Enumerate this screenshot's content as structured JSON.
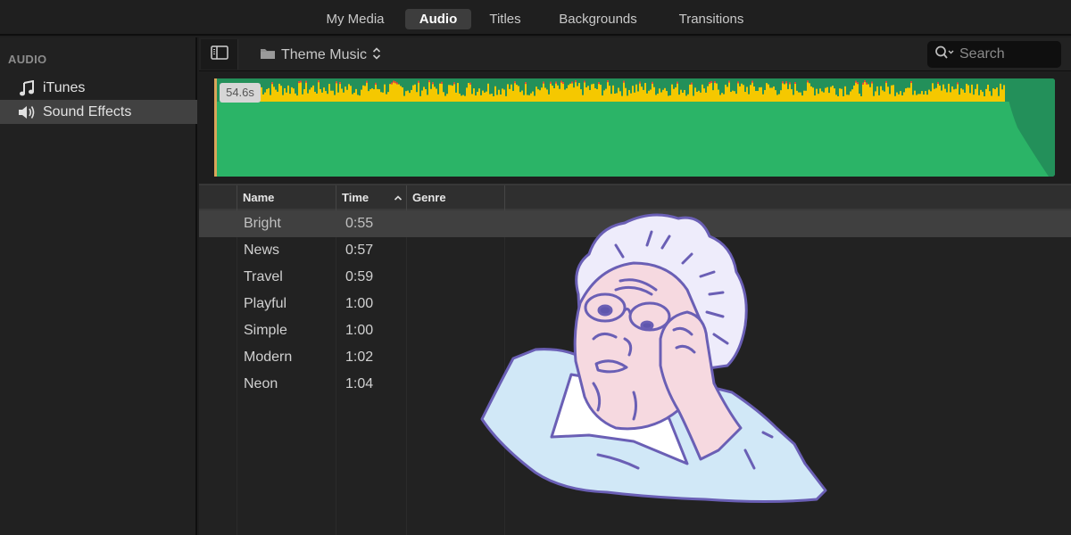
{
  "top_tabs": [
    {
      "label": "My Media",
      "active": false
    },
    {
      "label": "Audio",
      "active": true
    },
    {
      "label": "Titles",
      "active": false
    },
    {
      "label": "Backgrounds",
      "active": false
    },
    {
      "label": "Transitions",
      "active": false
    }
  ],
  "sidebar": {
    "heading": "AUDIO",
    "items": [
      {
        "label": "iTunes",
        "icon": "music-note-icon",
        "selected": false
      },
      {
        "label": "Sound Effects",
        "icon": "speaker-icon",
        "selected": true
      }
    ]
  },
  "toolbar": {
    "folder_label": "Theme Music",
    "search_placeholder": "Search"
  },
  "waveform": {
    "duration_label": "54.6s",
    "colors": {
      "body": "#2bb467",
      "peak": "#f5c800",
      "clip": "#e0453a",
      "fade": "#23905a"
    }
  },
  "table": {
    "columns": [
      "Name",
      "Time",
      "Genre"
    ],
    "sort_column": "Time",
    "sort_direction": "ascending",
    "rows": [
      {
        "name": "Bright",
        "time": "0:55",
        "genre": "",
        "selected": true
      },
      {
        "name": "News",
        "time": "0:57",
        "genre": ""
      },
      {
        "name": "Travel",
        "time": "0:59",
        "genre": ""
      },
      {
        "name": "Playful",
        "time": "1:00",
        "genre": ""
      },
      {
        "name": "Simple",
        "time": "1:00",
        "genre": ""
      },
      {
        "name": "Modern",
        "time": "1:02",
        "genre": ""
      },
      {
        "name": "Neon",
        "time": "1:04",
        "genre": ""
      }
    ]
  },
  "overlay": {
    "description": "illustration of elderly woman holding glasses, looking confused",
    "colors": {
      "outline": "#6a5fb5",
      "hair": "#eeecfb",
      "skin": "#f6d9e0",
      "shirt": "#d1e8f7",
      "collar": "#ffffff"
    }
  }
}
